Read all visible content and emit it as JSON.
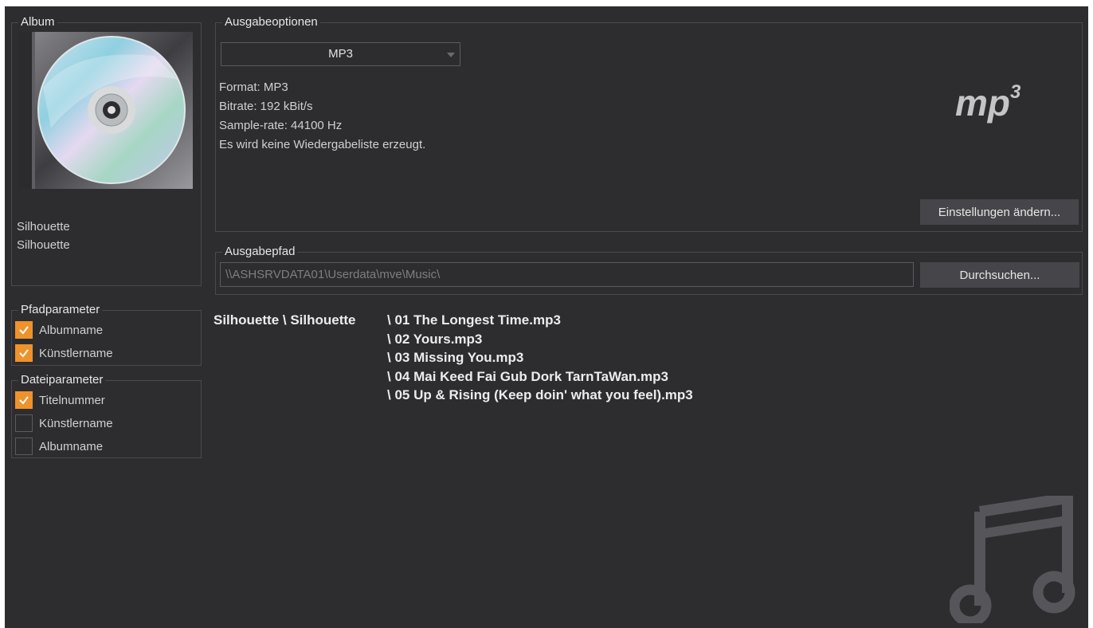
{
  "album": {
    "legend": "Album",
    "title": "Silhouette",
    "artist": "Silhouette"
  },
  "path_params": {
    "legend": "Pfadparameter",
    "items": [
      {
        "label": "Albumname",
        "checked": true
      },
      {
        "label": "Künstlername",
        "checked": true
      }
    ]
  },
  "file_params": {
    "legend": "Dateiparameter",
    "items": [
      {
        "label": "Titelnummer",
        "checked": true
      },
      {
        "label": "Künstlername",
        "checked": false
      },
      {
        "label": "Albumname",
        "checked": false
      }
    ]
  },
  "output_options": {
    "legend": "Ausgabeoptionen",
    "format_selected": "MP3",
    "info": [
      "Format: MP3",
      "Bitrate: 192 kBit/s",
      "Sample-rate: 44100 Hz",
      "Es wird keine Wiedergabeliste erzeugt."
    ],
    "logo_text": "mp",
    "logo_sup": "3",
    "settings_button": "Einstellungen ändern..."
  },
  "output_path": {
    "legend": "Ausgabepfad",
    "value": "\\\\ASHSRVDATA01\\Userdata\\mve\\Music\\",
    "browse_button": "Durchsuchen..."
  },
  "file_tree": {
    "prefix": "Silhouette \\ Silhouette",
    "files": [
      "\\ 01 The Longest Time.mp3",
      "\\ 02 Yours.mp3",
      "\\ 03 Missing You.mp3",
      "\\ 04 Mai Keed Fai Gub Dork TarnTaWan.mp3",
      "\\ 05 Up & Rising (Keep doin' what you feel).mp3"
    ]
  },
  "colors": {
    "background": "#2d2d30",
    "accent": "#f0922b",
    "button": "#46464a"
  },
  "icons": {
    "cover": "cd-case-icon",
    "checkbox": "checkmark-icon",
    "dropdown": "chevron-down-icon",
    "watermark": "music-note-icon"
  }
}
